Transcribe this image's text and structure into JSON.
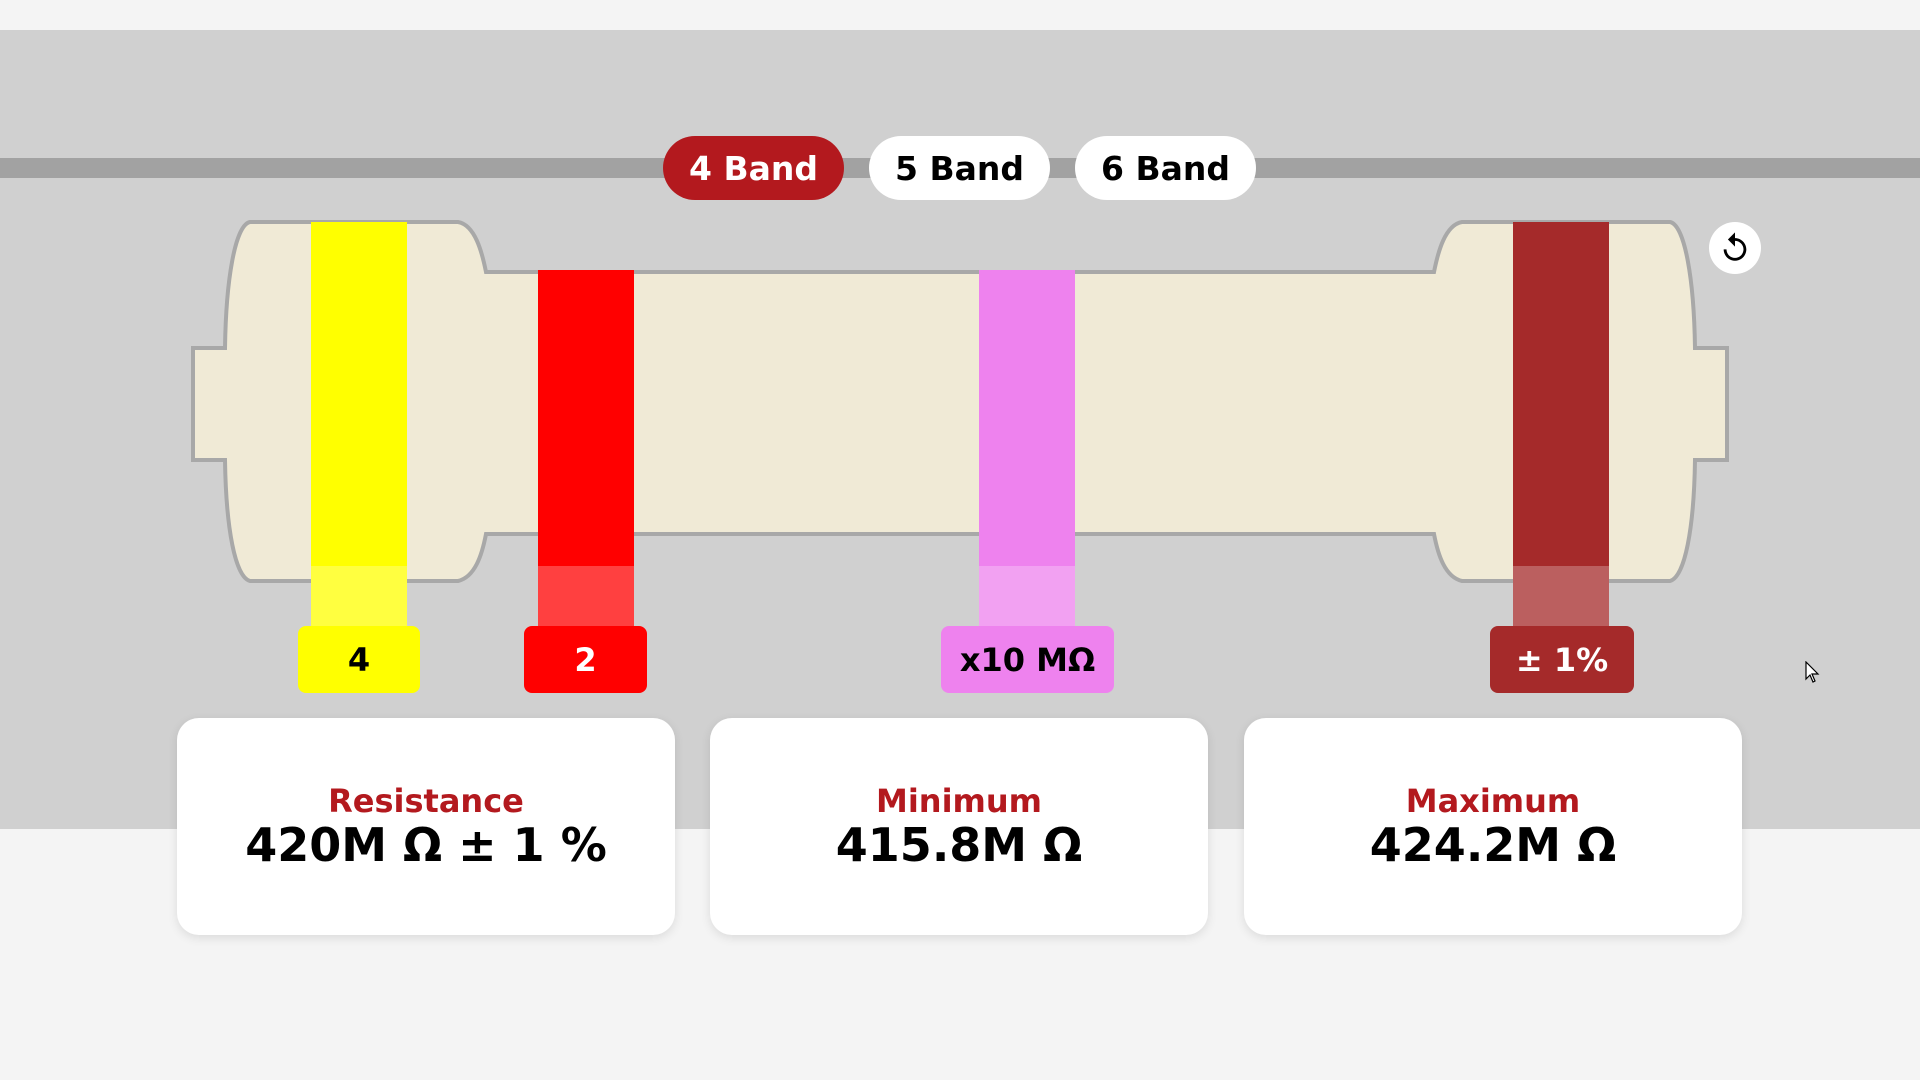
{
  "band_tabs": [
    {
      "label": "4 Band",
      "active": true
    },
    {
      "label": "5 Band",
      "active": false
    },
    {
      "label": "6 Band",
      "active": false
    }
  ],
  "reset": {
    "icon": "reset-icon"
  },
  "bands": [
    {
      "label": "4",
      "color": "#ffff00",
      "label_color": "#ffff00",
      "text_color": "#000000"
    },
    {
      "label": "2",
      "color": "#ff0000",
      "label_color": "#ff0000",
      "text_color": "#ffffff"
    },
    {
      "label": "x10 MΩ",
      "color": "#ee82ee",
      "label_color": "#ee82ee",
      "text_color": "#000000"
    },
    {
      "label": "± 1%",
      "color": "#a52a2a",
      "label_color": "#a52a2a",
      "text_color": "#ffffff"
    }
  ],
  "cards": {
    "resistance": {
      "title": "Resistance",
      "value": "420M Ω ± 1 %"
    },
    "minimum": {
      "title": "Minimum",
      "value": "415.8M Ω"
    },
    "maximum": {
      "title": "Maximum",
      "value": "424.2M Ω"
    }
  },
  "colors": {
    "accent": "#b3191e",
    "body": "#f0ead6",
    "outline": "#a8a8a8",
    "background": "#d0d0d0"
  }
}
